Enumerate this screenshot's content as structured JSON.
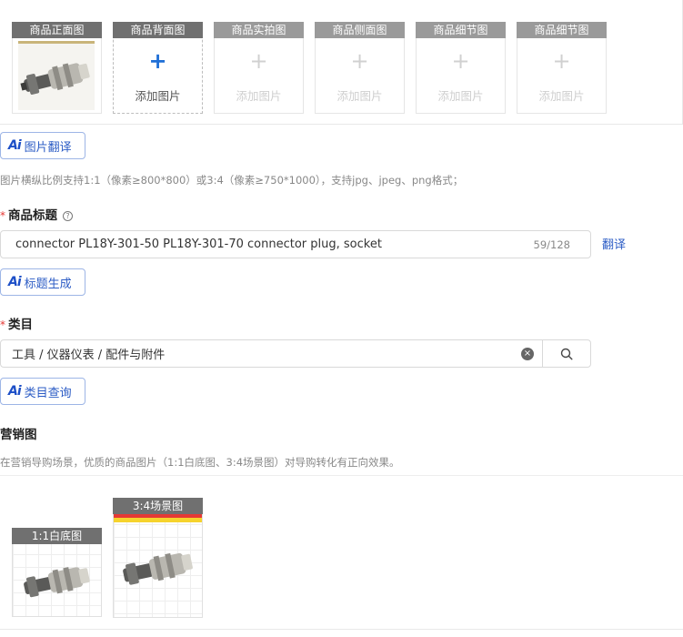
{
  "image_slots": [
    {
      "label": "商品正面图",
      "state": "filled"
    },
    {
      "label": "商品背面图",
      "state": "active",
      "plus": "+",
      "add_text": "添加图片"
    },
    {
      "label": "商品实拍图",
      "state": "disabled",
      "plus": "+",
      "add_text": "添加图片"
    },
    {
      "label": "商品侧面图",
      "state": "disabled",
      "plus": "+",
      "add_text": "添加图片"
    },
    {
      "label": "商品细节图",
      "state": "disabled",
      "plus": "+",
      "add_text": "添加图片"
    },
    {
      "label": "商品细节图",
      "state": "disabled",
      "plus": "+",
      "add_text": "添加图片"
    }
  ],
  "ai_translate_btn": {
    "mark": "Ai",
    "label": "图片翻译"
  },
  "image_hint": "图片横纵比例支持1:1（像素≥800*800）或3:4（像素≥750*1000），支持jpg、jpeg、png格式；",
  "title_field": {
    "required_mark": "*",
    "label": "商品标题",
    "help_icon": "?",
    "value": "connector PL18Y-301-50 PL18Y-301-70 connector plug, socket",
    "count": "59/128",
    "translate_link": "翻译"
  },
  "ai_title_btn": {
    "mark": "Ai",
    "label": "标题生成"
  },
  "category_field": {
    "required_mark": "*",
    "label": "类目",
    "value": "工具 / 仪器仪表 / 配件与附件",
    "clear_icon": "×"
  },
  "ai_category_btn": {
    "mark": "Ai",
    "label": "类目查询"
  },
  "marketing": {
    "label": "营销图",
    "hint": "在营销导购场景，优质的商品图片（1:1白底图、3:4场景图）对导购转化有正向效果。",
    "slots": [
      {
        "label": "1:1白底图"
      },
      {
        "label": "3:4场景图"
      }
    ]
  },
  "colors": {
    "accent": "#2c5cc5",
    "required": "#e53935",
    "slot_label_bg": "#707070"
  }
}
